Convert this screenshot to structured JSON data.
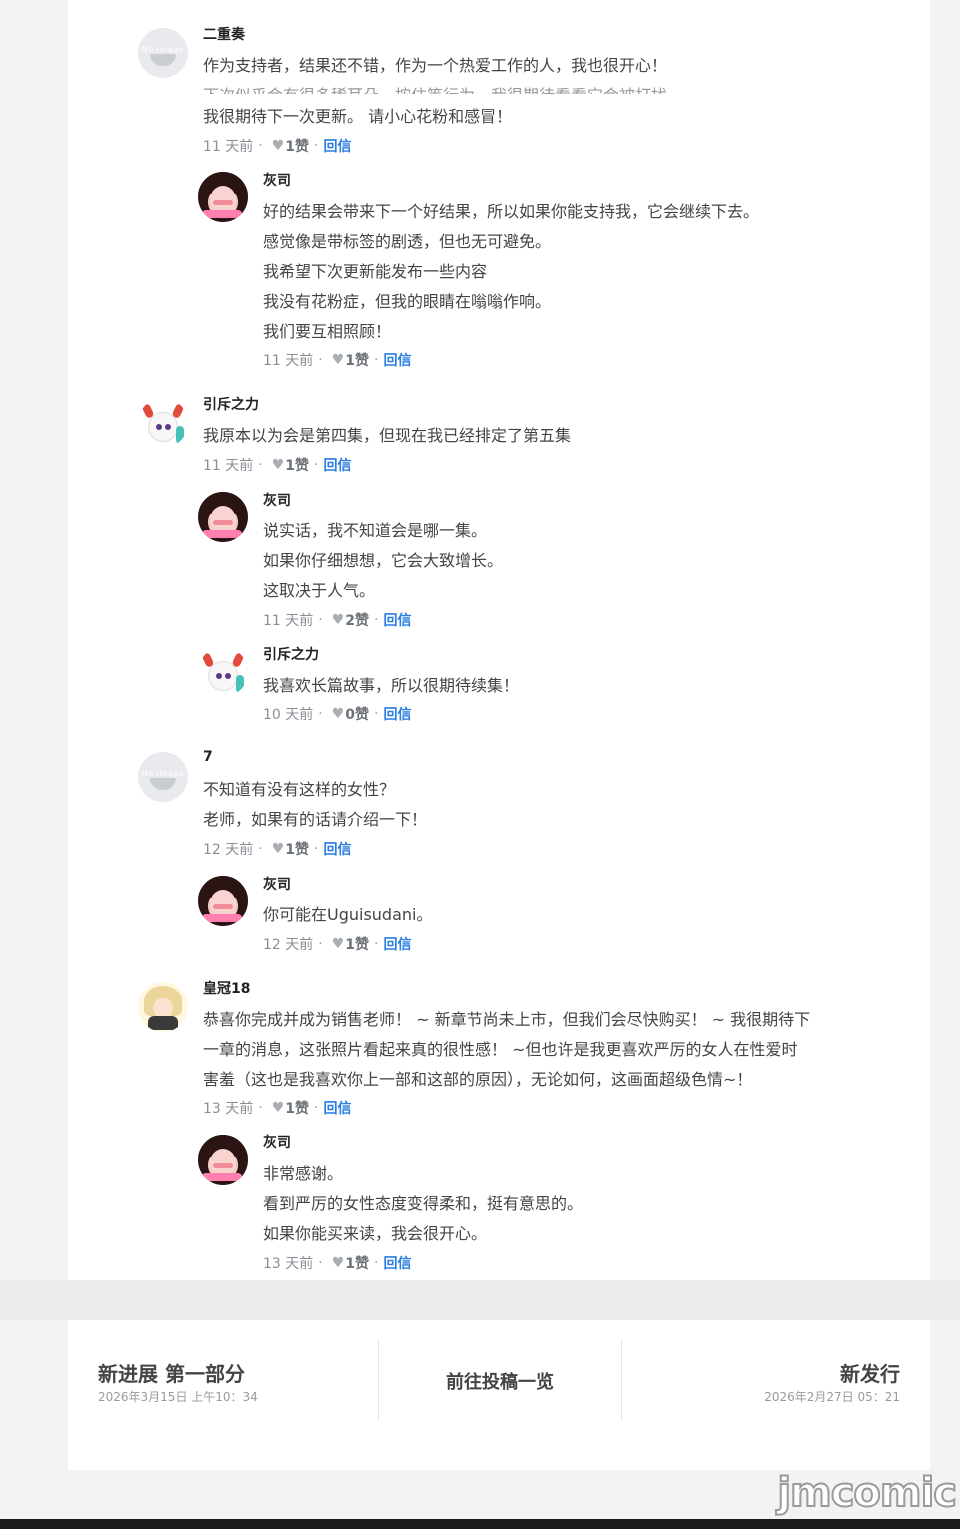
{
  "comments": [
    {
      "user": "二重奏",
      "lines": [
        "作为支持者，结果还不错，作为一个热爱工作的人，我也很开心！"
      ],
      "faded_line": "下次似乎会有很多稀耳朵　按住等行为　我很期待看看它会被打扰",
      "lines_after": [
        "我很期待下一次更新。 请小心花粉和感冒！"
      ],
      "time": "11 天前",
      "likes": "1赞",
      "reply": "回信",
      "avatar_text": "No Image"
    },
    {
      "user": "灰司",
      "lines": [
        "好的结果会带来下一个好结果，所以如果你能支持我，它会继续下去。",
        "感觉像是带标签的剧透，但也无可避免。",
        "我希望下次更新能发布一些内容",
        "我没有花粉症，但我的眼睛在嗡嗡作响。",
        "我们要互相照顾！"
      ],
      "time": "11 天前",
      "likes": "1赞",
      "reply": "回信"
    },
    {
      "user": "引斥之力",
      "lines": [
        "我原本以为会是第四集，但现在我已经排定了第五集"
      ],
      "time": "11 天前",
      "likes": "1赞",
      "reply": "回信"
    },
    {
      "user": "灰司",
      "lines": [
        "说实话，我不知道会是哪一集。",
        "如果你仔细想想，它会大致增长。",
        "这取决于人气。"
      ],
      "time": "11 天前",
      "likes": "2赞",
      "reply": "回信"
    },
    {
      "user": "引斥之力",
      "lines": [
        "我喜欢长篇故事，所以很期待续集！"
      ],
      "time": "10 天前",
      "likes": "0赞",
      "reply": "回信"
    },
    {
      "user": "7",
      "lines": [
        "不知道有没有这样的女性？",
        "老师，如果有的话请介绍一下！"
      ],
      "time": "12 天前",
      "likes": "1赞",
      "reply": "回信",
      "avatar_text": "No Image"
    },
    {
      "user": "灰司",
      "lines": [
        "你可能在Uguisudani。"
      ],
      "time": "12 天前",
      "likes": "1赞",
      "reply": "回信"
    },
    {
      "user": "皇冠18",
      "lines": [
        "恭喜你完成并成为销售老师！ ~ 新章节尚未上市，但我们会尽快购买！ ~ 我很期待下",
        "一章的消息，这张照片看起来真的很性感！ ~但也许是我更喜欢严厉的女人在性爱时",
        "害羞（这也是我喜欢你上一部和这部的原因），无论如何，这画面超级色情~！"
      ],
      "time": "13 天前",
      "likes": "1赞",
      "reply": "回信"
    },
    {
      "user": "灰司",
      "lines": [
        "非常感谢。",
        "看到严厉的女性态度变得柔和，挺有意思的。",
        "如果你能买来读，我会很开心。"
      ],
      "time": "13 天前",
      "likes": "1赞",
      "reply": "回信"
    }
  ],
  "nav": {
    "prev_title": "新进展 第一部分",
    "prev_date": "2026年3月15日 上午10：34",
    "center_label": "前往投稿一览",
    "next_title": "新发行",
    "next_date": "2026年2月27日 05：21"
  },
  "watermark": "jmcomic",
  "colors": {
    "reply_link": "#2a7de1",
    "meta_text": "#8a8f96"
  }
}
